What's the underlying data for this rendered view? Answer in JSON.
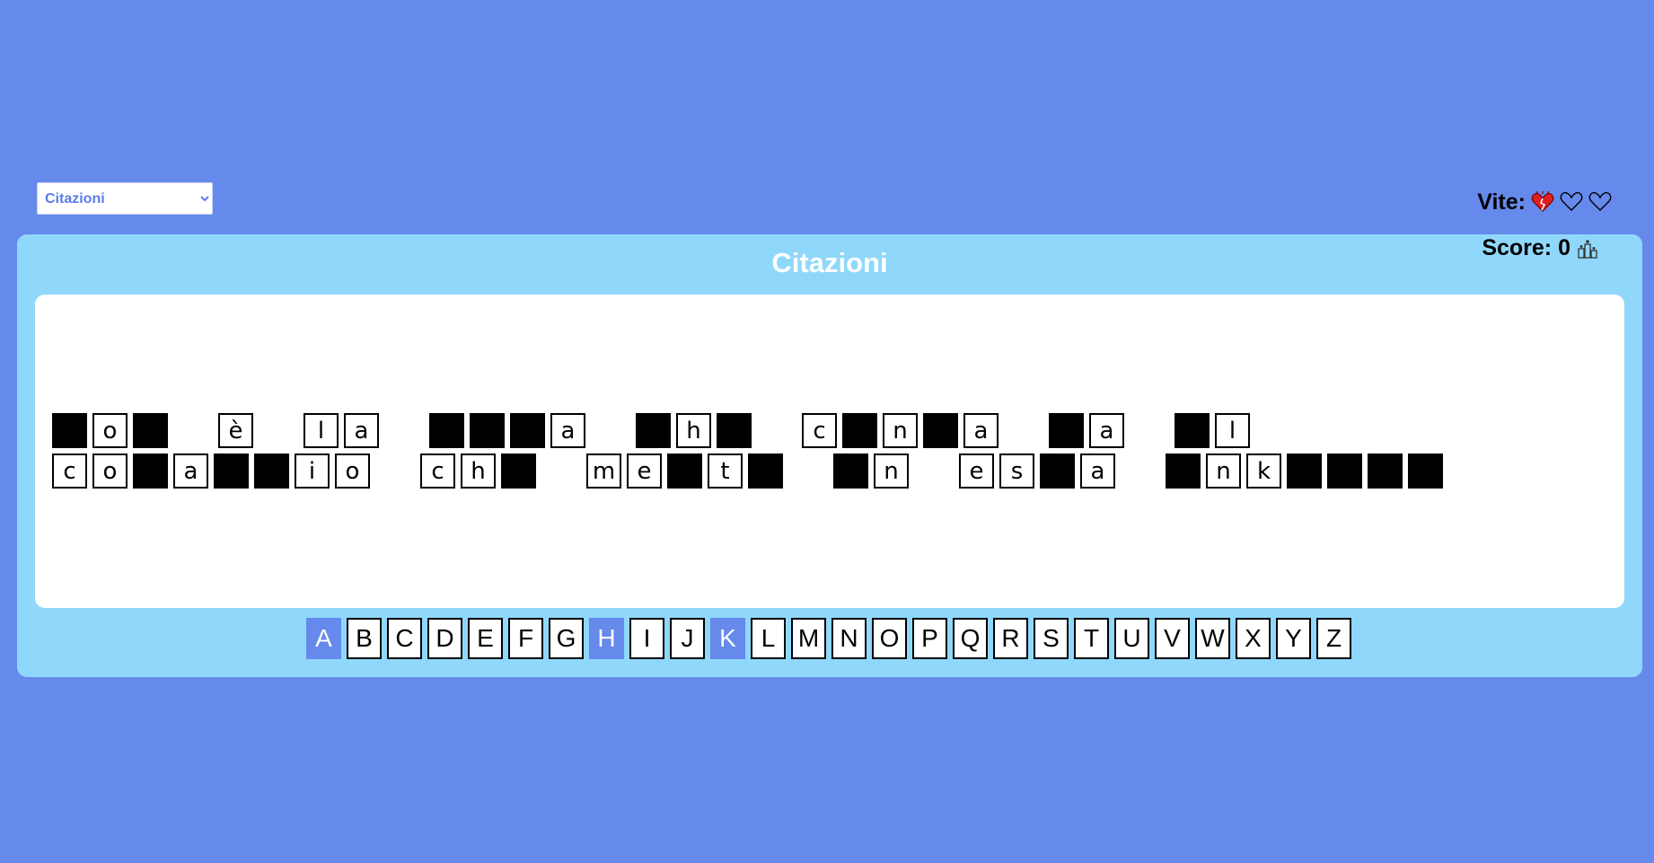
{
  "category": {
    "selected": "Citazioni"
  },
  "lives": {
    "label": "Vite:",
    "icons": [
      "heart-broken-icon",
      "heart-outline-icon",
      "heart-outline-icon"
    ]
  },
  "score": {
    "label": "Score: 0",
    "icon": "trophy-icon"
  },
  "panel": {
    "title": "Citazioni"
  },
  "phrase": [
    [
      "",
      "o",
      ""
    ],
    [
      "è"
    ],
    [
      "l",
      "a"
    ],
    [
      "",
      "",
      "",
      "a"
    ],
    [
      "",
      "h",
      ""
    ],
    [
      "c",
      "",
      "n",
      "",
      "a"
    ],
    [
      "",
      "a"
    ],
    [
      "",
      "l"
    ],
    [
      "c",
      "o",
      "",
      "a",
      "",
      "",
      "i",
      "o"
    ],
    [
      "c",
      "h",
      ""
    ],
    [
      "m",
      "e",
      "",
      "t",
      ""
    ],
    [
      "",
      "n"
    ],
    [
      "e",
      "s",
      "",
      "a"
    ],
    [
      "",
      "n",
      "k",
      "",
      "",
      "",
      ""
    ]
  ],
  "keyboard": {
    "keys": [
      "A",
      "B",
      "C",
      "D",
      "E",
      "F",
      "G",
      "H",
      "I",
      "J",
      "K",
      "L",
      "M",
      "N",
      "O",
      "P",
      "Q",
      "R",
      "S",
      "T",
      "U",
      "V",
      "W",
      "X",
      "Y",
      "Z"
    ],
    "used": [
      "A",
      "H",
      "K"
    ]
  },
  "colors": {
    "background": "#6689ec",
    "panel": "#8fd8fb",
    "used_key": "#6689ec"
  }
}
